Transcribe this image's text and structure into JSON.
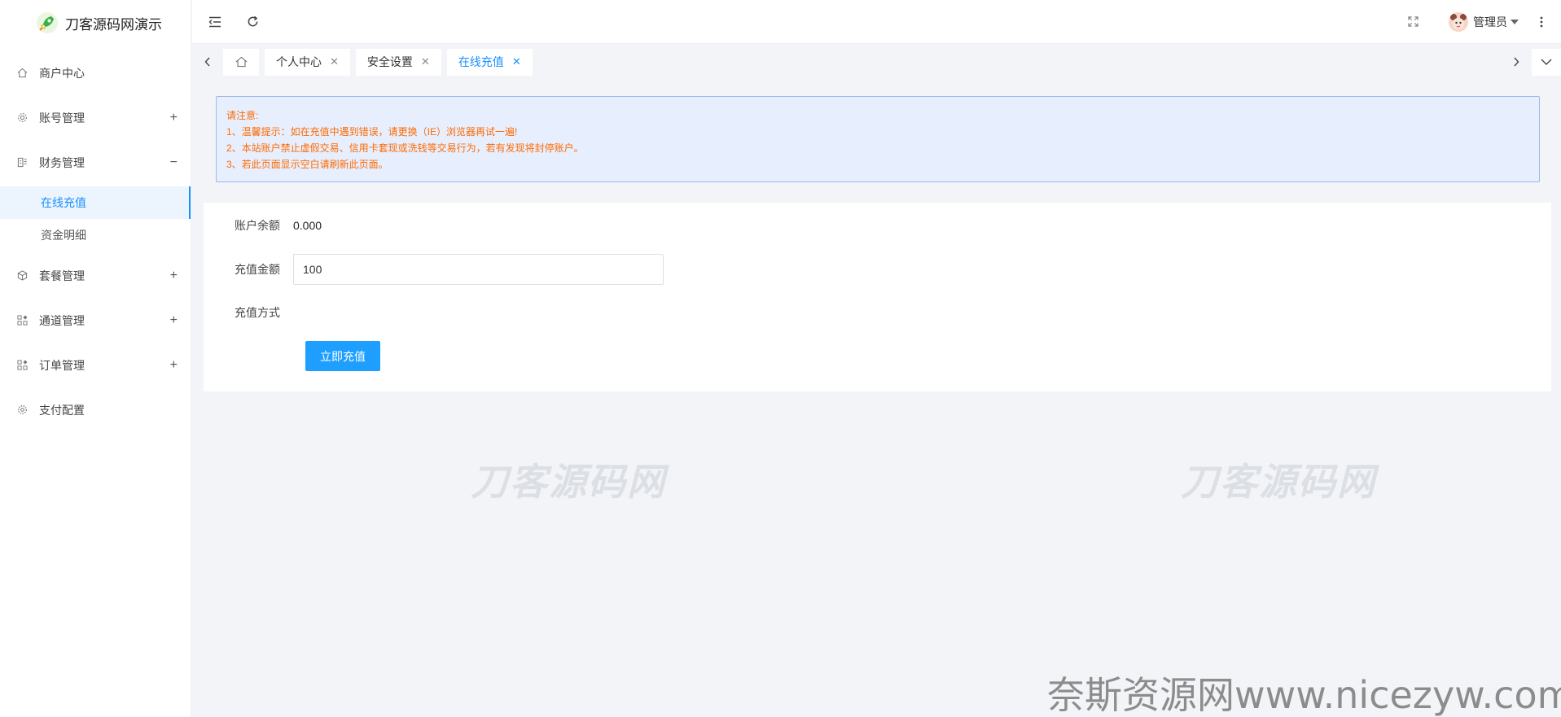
{
  "app": {
    "logo_text": "刀客源码网演示"
  },
  "sidebar": {
    "items": [
      {
        "label": "商户中心",
        "icon": "home-icon"
      },
      {
        "label": "账号管理",
        "icon": "gear-icon",
        "toggle": "+"
      },
      {
        "label": "财务管理",
        "icon": "finance-icon",
        "toggle": "−",
        "children": [
          {
            "label": "在线充值",
            "active": true
          },
          {
            "label": "资金明细"
          }
        ]
      },
      {
        "label": "套餐管理",
        "icon": "package-icon",
        "toggle": "+"
      },
      {
        "label": "通道管理",
        "icon": "grid-icon",
        "toggle": "+"
      },
      {
        "label": "订单管理",
        "icon": "grid-icon",
        "toggle": "+"
      },
      {
        "label": "支付配置",
        "icon": "cog-icon"
      }
    ]
  },
  "header": {
    "user_name": "管理员"
  },
  "tabs": [
    {
      "label": "个人中心"
    },
    {
      "label": "安全设置"
    },
    {
      "label": "在线充值",
      "active": true
    }
  ],
  "notice": {
    "lines": [
      "请注意:",
      "1、温馨提示：如在充值中遇到错误，请更换（IE）浏览器再试一遍!",
      "2、本站账户禁止虚假交易、信用卡套现或洗钱等交易行为，若有发现将封停账户。",
      "3、若此页面显示空白请刷新此页面。"
    ]
  },
  "form": {
    "balance_label": "账户余额",
    "balance_value": "0.000",
    "amount_label": "充值金额",
    "amount_value": "100",
    "method_label": "充值方式",
    "submit_label": "立即充值"
  },
  "watermarks": {
    "brand": "刀客源码网",
    "site": "奈斯资源网www.nicezyw.com"
  },
  "colors": {
    "accent": "#1890ff",
    "button": "#1e9fff",
    "notice_text": "#ff6a00",
    "notice_bg": "#e7efff"
  }
}
